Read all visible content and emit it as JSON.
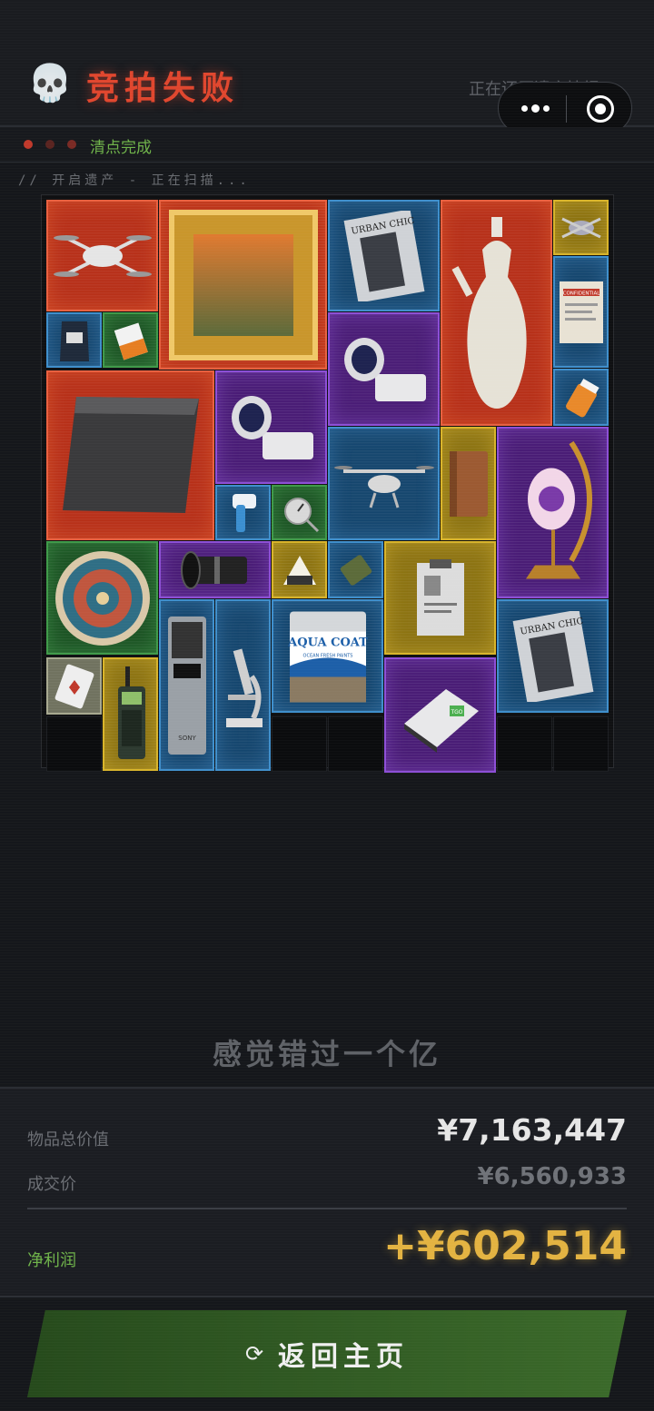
{
  "header": {
    "title": "竞拍失败",
    "skull_icon": "💀",
    "restore_text": "正在还原遗产情报 .",
    "status_text": "清点完成",
    "scan_text": "// 开启遗产 - 正在扫描..."
  },
  "grid": {
    "items": [
      {
        "name": "drone-gray",
        "rarity": "red",
        "icon": "drone-icon"
      },
      {
        "name": "framed-painting",
        "rarity": "red",
        "icon": "painting-icon"
      },
      {
        "name": "urban-chic-magazine",
        "rarity": "blue",
        "icon": "magazine-icon",
        "label": "URBAN CHIC"
      },
      {
        "name": "porcelain-ewer",
        "rarity": "red",
        "icon": "vase-icon"
      },
      {
        "name": "mini-drone",
        "rarity": "gold",
        "icon": "drone-icon"
      },
      {
        "name": "confidential-file",
        "rarity": "blue",
        "icon": "document-icon",
        "label": "CONFIDENTIAL"
      },
      {
        "name": "coffee-bag",
        "rarity": "blue",
        "icon": "coffee-bag-icon"
      },
      {
        "name": "battery",
        "rarity": "green",
        "icon": "battery-icon"
      },
      {
        "name": "telescope-mount",
        "rarity": "purple",
        "icon": "telescope-icon"
      },
      {
        "name": "pill-bottle",
        "rarity": "blue",
        "icon": "pill-bottle-icon"
      },
      {
        "name": "dark-slab",
        "rarity": "red",
        "icon": "slab-icon"
      },
      {
        "name": "telescope-base",
        "rarity": "purple",
        "icon": "telescope-icon"
      },
      {
        "name": "quadcopter",
        "rarity": "blue",
        "icon": "drone-icon"
      },
      {
        "name": "leather-journal",
        "rarity": "gold",
        "icon": "journal-icon"
      },
      {
        "name": "crescent-lamp",
        "rarity": "purple",
        "icon": "lamp-icon"
      },
      {
        "name": "thermometer-gun",
        "rarity": "blue",
        "icon": "thermometer-icon"
      },
      {
        "name": "dial-thermometer",
        "rarity": "green",
        "icon": "gauge-icon"
      },
      {
        "name": "ornate-plate",
        "rarity": "green",
        "icon": "plate-icon"
      },
      {
        "name": "camera-lens",
        "rarity": "purple",
        "icon": "lens-icon"
      },
      {
        "name": "onigiri",
        "rarity": "gold",
        "icon": "onigiri-icon"
      },
      {
        "name": "mre-pack",
        "rarity": "blue",
        "icon": "ration-icon"
      },
      {
        "name": "clipboard",
        "rarity": "gold",
        "icon": "clipboard-icon"
      },
      {
        "name": "recorder-device",
        "rarity": "blue",
        "icon": "recorder-icon",
        "label": "SONY"
      },
      {
        "name": "microscope",
        "rarity": "blue",
        "icon": "microscope-icon"
      },
      {
        "name": "aqua-coat-paint",
        "rarity": "blue",
        "icon": "paint-can-icon",
        "label": "AQUA COAT",
        "sublabel": "OCEAN FRESH PAINTS"
      },
      {
        "name": "urban-chic-magazine-2",
        "rarity": "blue",
        "icon": "magazine-icon",
        "label": "URBAN CHIC"
      },
      {
        "name": "playing-card",
        "rarity": "gray",
        "icon": "card-icon"
      },
      {
        "name": "radio-phone",
        "rarity": "gold",
        "icon": "radio-icon"
      },
      {
        "name": "tgo-device",
        "rarity": "purple",
        "icon": "tablet-icon",
        "label": "TGO"
      }
    ]
  },
  "summary": {
    "tagline": "感觉错过一个亿",
    "total_label": "物品总价值",
    "total_value": "¥7,163,447",
    "deal_label": "成交价",
    "deal_value": "¥6,560,933",
    "profit_label": "净利润",
    "profit_value": "+¥602,514"
  },
  "footer": {
    "home_icon": "⟳",
    "home_label": "返回主页"
  }
}
